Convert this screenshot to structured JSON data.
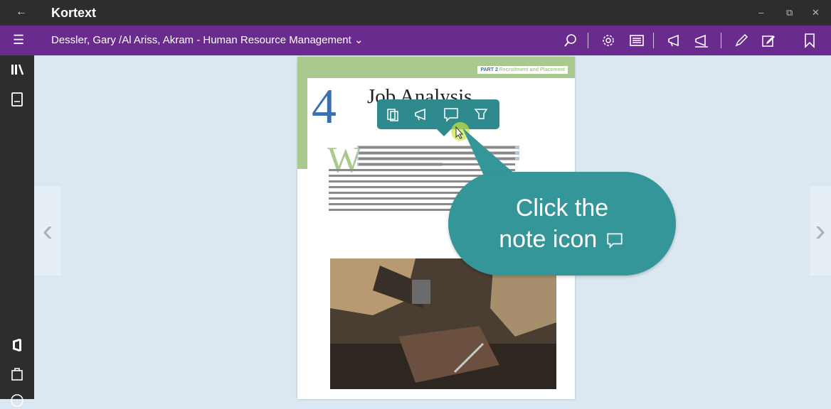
{
  "app": {
    "title": "Kortext",
    "back_icon": "←",
    "window_controls": {
      "minimize": "–",
      "restore": "⧉",
      "close": "✕"
    }
  },
  "toolbar": {
    "menu_icon": "☰",
    "book_title": "Dessler, Gary /Al Ariss, Akram - Human Resource Management",
    "dropdown_icon": "⌄",
    "icons": [
      "search-icon",
      "settings-icon",
      "table-of-contents-icon",
      "highlight-icon",
      "notes-icon",
      "pencil-icon",
      "edit-note-icon",
      "bookmark-icon"
    ]
  },
  "sidebar": {
    "icons": [
      "library-icon",
      "book-icon",
      "office-icon",
      "bag-icon"
    ]
  },
  "navigation": {
    "prev": "‹",
    "next": "›"
  },
  "page": {
    "part_label": "PART 2",
    "part_subtitle": "Recruitment and Placement",
    "chapter_number": "4",
    "chapter_title": "Job Analysis",
    "dropcap": "W"
  },
  "selection_popup": {
    "icons": [
      "copy-icon",
      "highlight-icon",
      "note-icon",
      "clear-highlight-icon"
    ]
  },
  "callout": {
    "line1": "Click the",
    "line2": "note icon"
  },
  "colors": {
    "accent_purple": "#6a2b8f",
    "teal": "#2f8a8e",
    "green": "#a9c98e"
  }
}
